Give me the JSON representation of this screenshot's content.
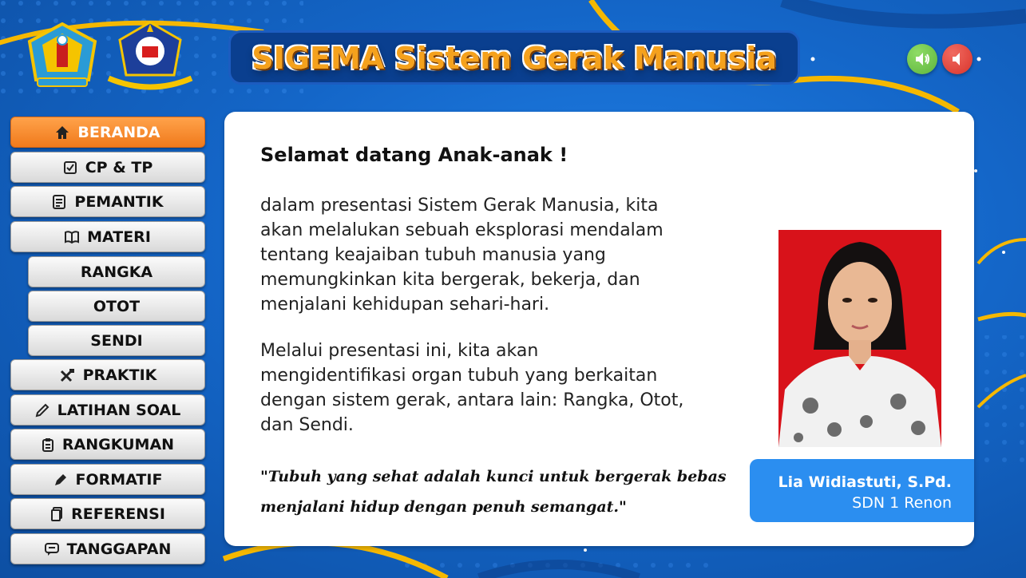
{
  "header": {
    "title": "SIGEMA  Sistem Gerak Manusia",
    "logos": [
      "school-district-emblem",
      "school-crest"
    ]
  },
  "sound": {
    "on_icon": "speaker-on-icon",
    "off_icon": "speaker-mute-icon",
    "on_color": "#5eb53c",
    "off_color": "#d9342b"
  },
  "sidebar": {
    "items": [
      {
        "label": "BERANDA",
        "icon": "home-icon",
        "active": true
      },
      {
        "label": "CP & TP",
        "icon": "checklist-icon"
      },
      {
        "label": "PEMANTIK",
        "icon": "note-icon"
      },
      {
        "label": "MATERI",
        "icon": "book-icon"
      },
      {
        "label": "RANGKA",
        "icon": ""
      },
      {
        "label": "OTOT",
        "icon": ""
      },
      {
        "label": "SENDI",
        "icon": ""
      },
      {
        "label": "PRAKTIK",
        "icon": "tools-icon"
      },
      {
        "label": "LATIHAN SOAL",
        "icon": "pencil-icon"
      },
      {
        "label": "RANGKUMAN",
        "icon": "clipboard-icon"
      },
      {
        "label": "FORMATIF",
        "icon": "pen-icon"
      },
      {
        "label": "REFERENSI",
        "icon": "documents-icon"
      },
      {
        "label": "TANGGAPAN",
        "icon": "chat-icon"
      }
    ]
  },
  "content": {
    "heading": "Selamat datang Anak-anak !",
    "paragraph1": [
      "dalam presentasi Sistem Gerak Manusia, kita",
      "akan melalukan sebuah eksplorasi mendalam",
      "tentang keajaiban tubuh manusia yang",
      "memungkinkan kita bergerak, bekerja, dan",
      "menjalani kehidupan sehari-hari."
    ],
    "paragraph2": [
      "Melalui presentasi ini, kita akan",
      "mengidentifikasi organ tubuh yang berkaitan",
      "dengan sistem gerak, antara lain: Rangka, Otot,",
      "dan Sendi."
    ],
    "quote": [
      "\"Tubuh yang sehat adalah kunci untuk bergerak bebas",
      "menjalani hidup dengan penuh semangat.\""
    ]
  },
  "teacher": {
    "name": "Lia Widiastuti, S.Pd.",
    "school": "SDN 1 Renon",
    "photo_background": "#d8121a"
  },
  "colors": {
    "background": "#1466c8",
    "accent_yellow": "#f5b800",
    "active_nav": "#f07a1c",
    "name_tag": "#2b8ef0"
  }
}
